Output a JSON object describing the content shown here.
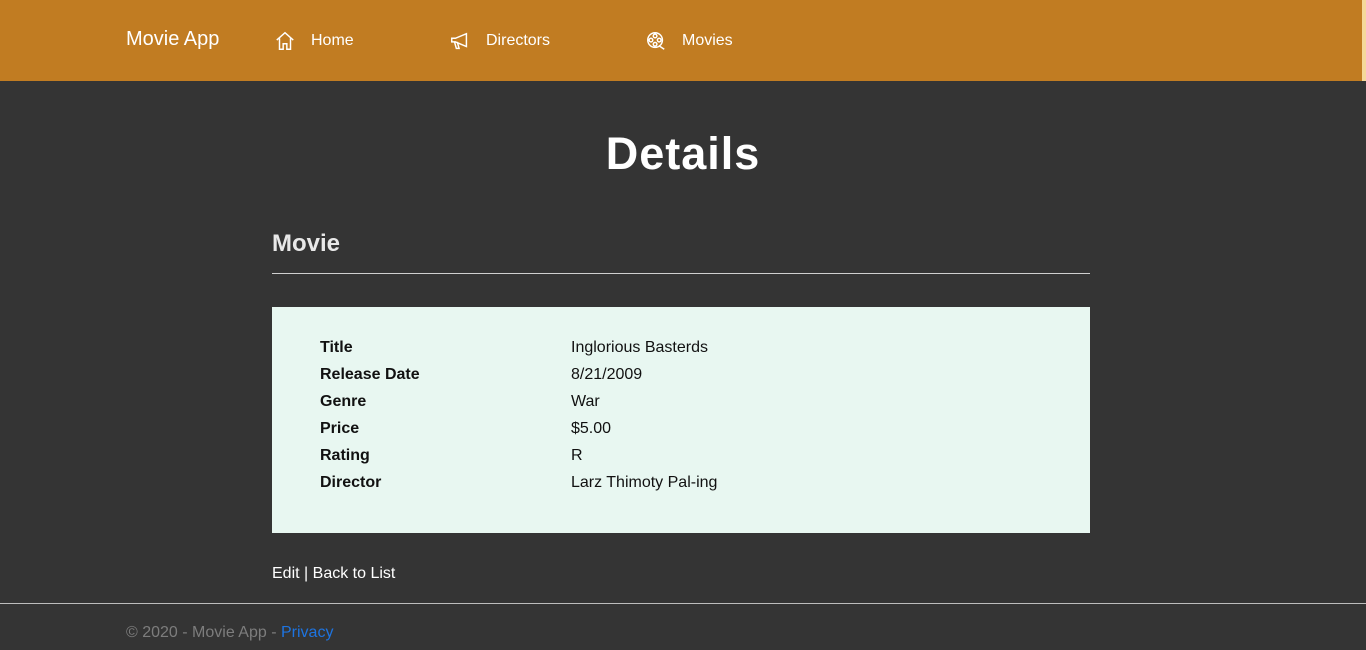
{
  "navbar": {
    "brand": "Movie App",
    "items": [
      {
        "label": "Home",
        "icon": "home-icon"
      },
      {
        "label": "Directors",
        "icon": "megaphone-icon"
      },
      {
        "label": "Movies",
        "icon": "film-reel-icon"
      }
    ],
    "background": "#c17c22"
  },
  "page": {
    "title": "Details",
    "section_title": "Movie"
  },
  "details": [
    {
      "label": "Title",
      "value": "Inglorious Basterds"
    },
    {
      "label": "Release Date",
      "value": "8/21/2009"
    },
    {
      "label": "Genre",
      "value": "War"
    },
    {
      "label": "Price",
      "value": "$5.00"
    },
    {
      "label": "Rating",
      "value": "R"
    },
    {
      "label": "Director",
      "value": "Larz Thimoty Pal-ing"
    }
  ],
  "actions": {
    "edit": "Edit",
    "separator": "|",
    "back": "Back to List"
  },
  "footer": {
    "text": "© 2020 - Movie App - ",
    "privacy": "Privacy"
  }
}
